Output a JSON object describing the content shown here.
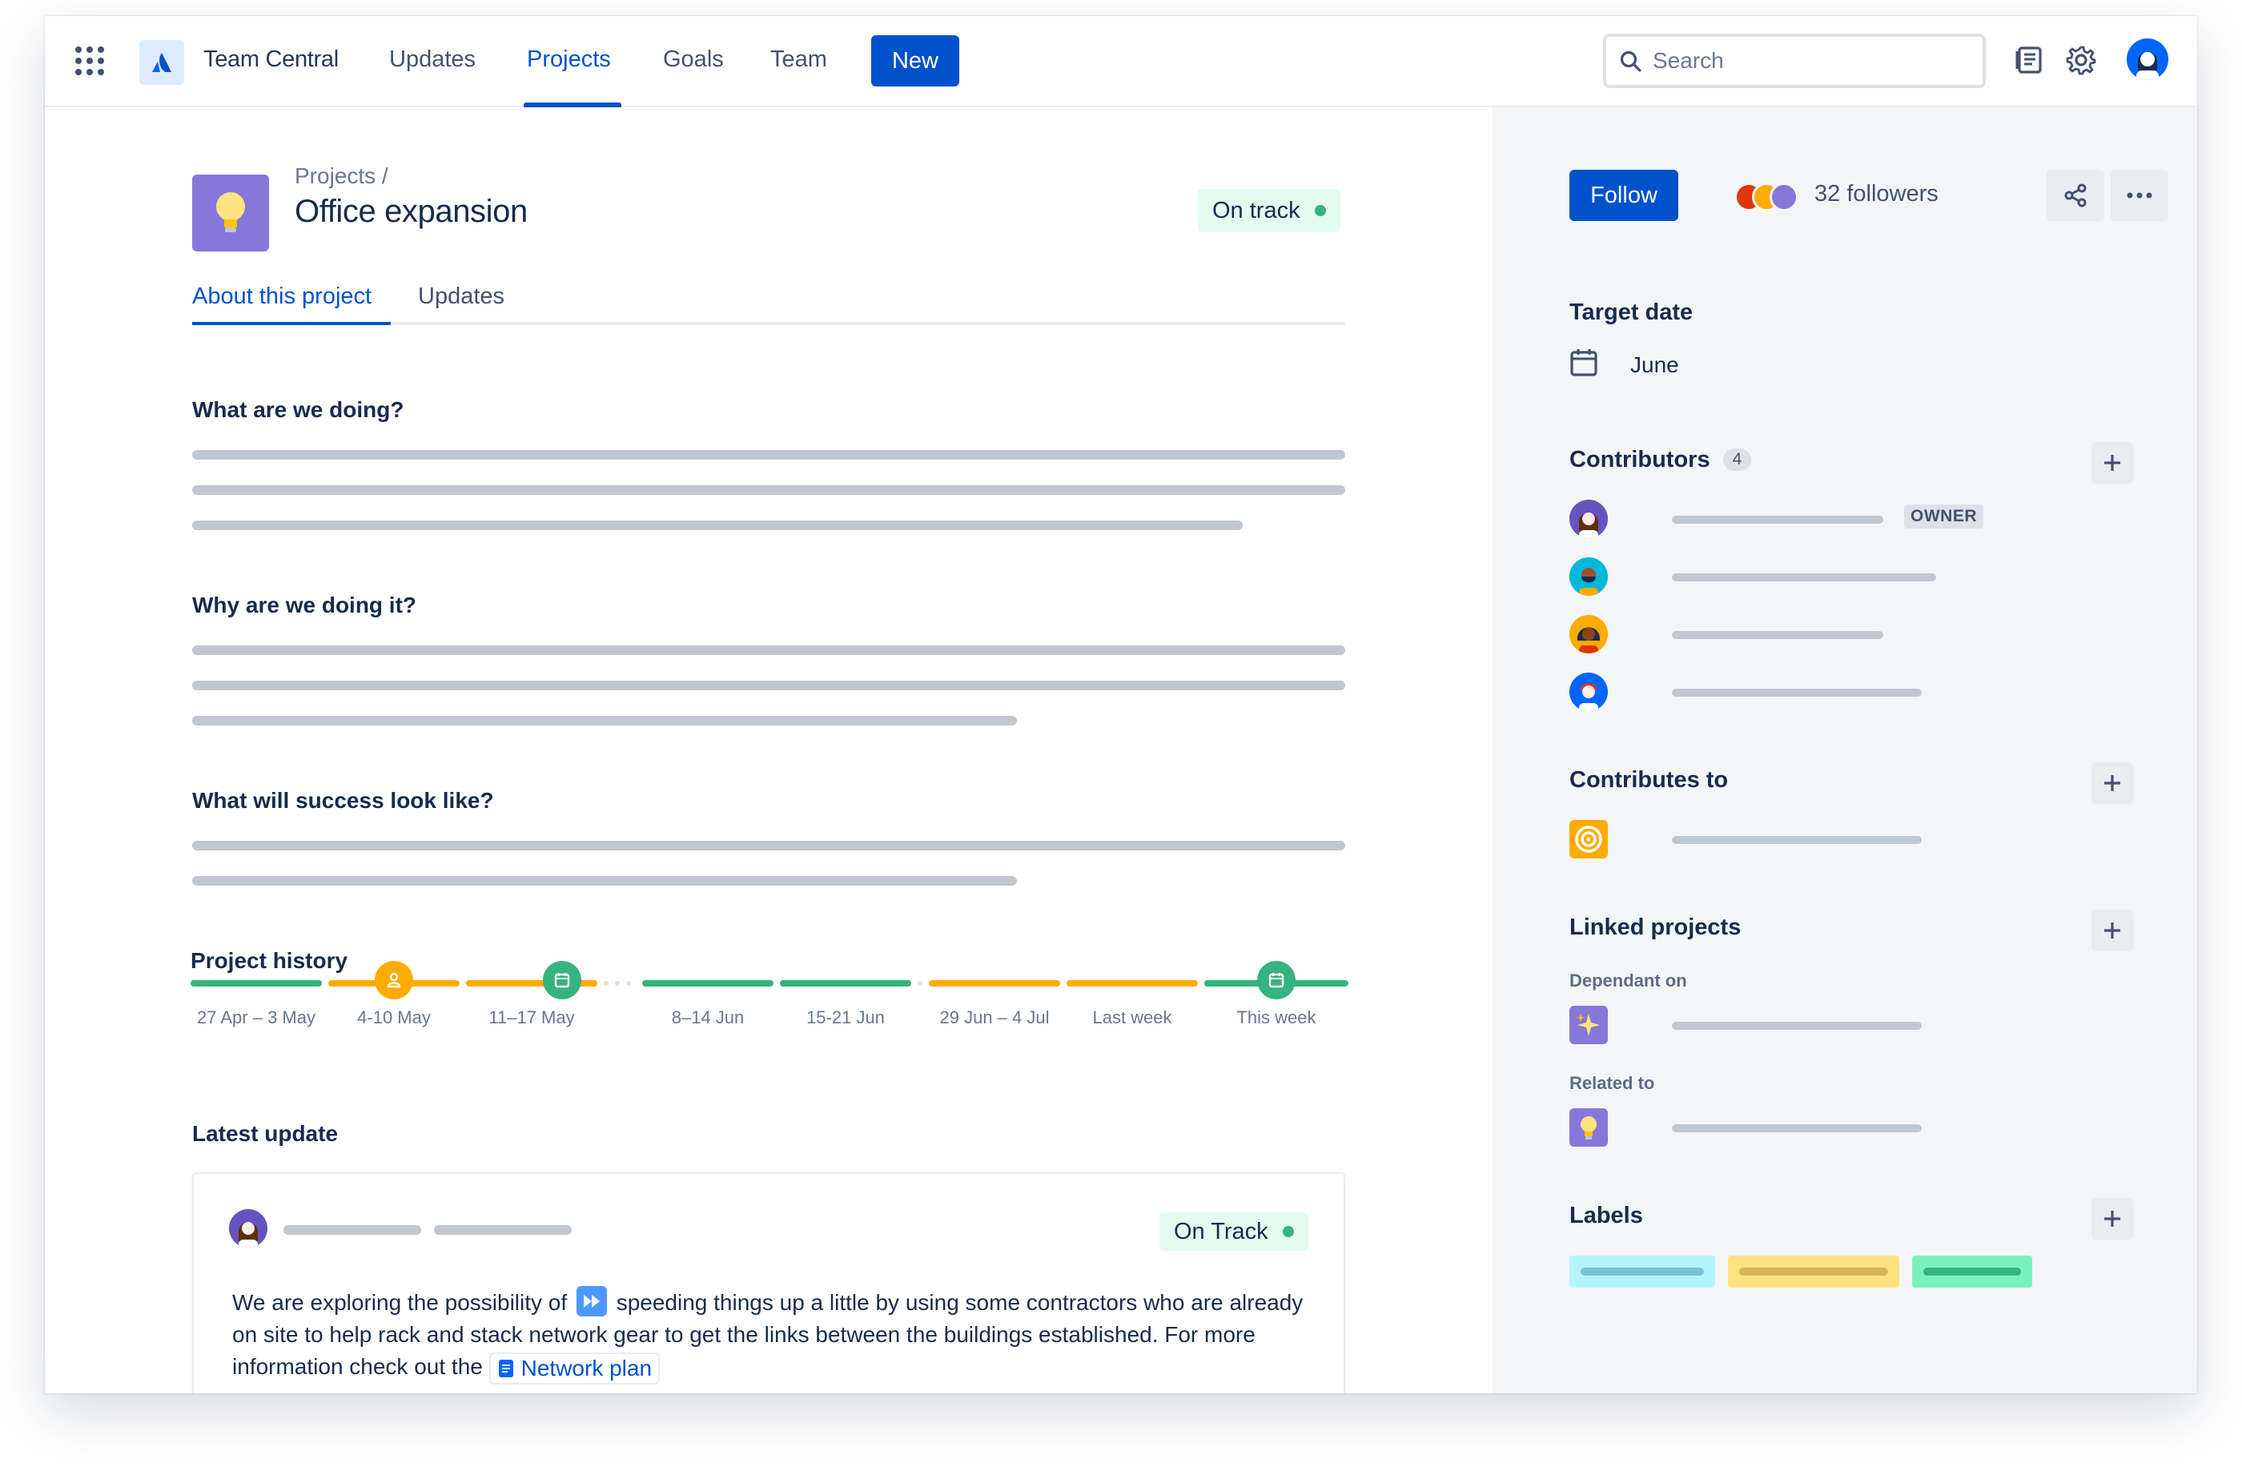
{
  "app": {
    "product_name": "Team Central",
    "nav": [
      {
        "label": "Updates"
      },
      {
        "label": "Projects"
      },
      {
        "label": "Goals"
      },
      {
        "label": "Team"
      }
    ],
    "new_label": "New",
    "search_placeholder": "Search"
  },
  "project": {
    "breadcrumb": "Projects  /",
    "title": "Office expansion",
    "status": "On track",
    "tabs": [
      {
        "label": "About this project"
      },
      {
        "label": "Updates"
      }
    ]
  },
  "sections": {
    "what": "What are we doing?",
    "why": "Why are we doing it?",
    "success": "What will success look like?"
  },
  "history": {
    "title": "Project history",
    "weeks": [
      "27 Apr – 3 May",
      "4-10 May",
      "11–17 May",
      "8–14 Jun",
      "15-21 Jun",
      "29 Jun – 4 Jul",
      "Last week",
      "This week"
    ]
  },
  "latest_update": {
    "title": "Latest update",
    "status": "On Track",
    "text_before": "We are exploring the possibility of",
    "text_after": "speeding things up a little by using some contractors who are already on site to help rack and stack network gear to get the links between the buildings established. For more information check out the",
    "link_label": "Network plan"
  },
  "sidebar": {
    "follow_label": "Follow",
    "followers": "32 followers",
    "target_date_heading": "Target date",
    "target_date": "June",
    "contributors_heading": "Contributors",
    "contributors_count": "4",
    "owner_label": "OWNER",
    "contributes_to_heading": "Contributes to",
    "linked_projects_heading": "Linked projects",
    "dependant_on": "Dependant on",
    "related_to": "Related to",
    "labels_heading": "Labels"
  },
  "colors": {
    "primary": "#0052cc",
    "on_track": "#36b37e",
    "at_risk": "#ffab00",
    "sidebar_bg": "#f4f5f7"
  }
}
